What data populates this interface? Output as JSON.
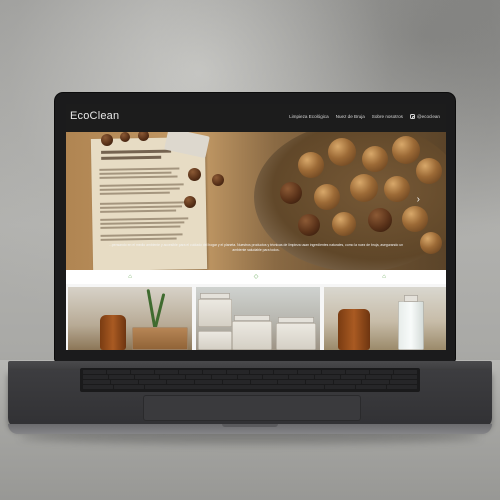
{
  "site": {
    "logo": "EcoClean",
    "nav": [
      "Limpieza Ecológica",
      "Nuez de Bruja",
      "Sobre nosotros"
    ],
    "instagram_handle": "@ecoclean",
    "instagram_icon": "instagram-icon"
  },
  "hero": {
    "caption": "...pensando en el medio ambiente y accesible para el cuidado del hogar y el planeta. Nuestros productos y técnicas de limpieza usan ingredientes naturales, como la nuez de bruja, asegurando un ambiente saludable para todos.",
    "next_arrow": "›"
  },
  "features": {
    "icons": [
      "leaf-icon",
      "drop-icon",
      "leaf-icon"
    ],
    "glyphs": [
      "⌂",
      "◇",
      "⌂"
    ],
    "accent": "#6cab5d"
  }
}
